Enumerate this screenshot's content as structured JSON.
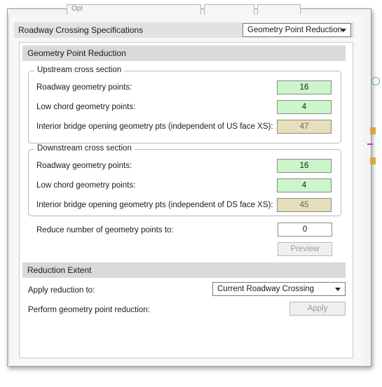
{
  "top_strip": {
    "partial_label": "Opt"
  },
  "spec_bar": {
    "title": "Roadway Crossing Specifications",
    "mode_select": "Geometry Point Reduction"
  },
  "gpr": {
    "header": "Geometry Point Reduction",
    "upstream": {
      "title": "Upstream cross section",
      "roadway_label": "Roadway geometry points:",
      "roadway_value": "16",
      "lowchord_label": "Low chord geometry points:",
      "lowchord_value": "4",
      "interior_label": "Interior bridge opening geometry pts (independent of US face XS):",
      "interior_value": "47"
    },
    "downstream": {
      "title": "Downstream cross section",
      "roadway_label": "Roadway geometry points:",
      "roadway_value": "16",
      "lowchord_label": "Low chord geometry points:",
      "lowchord_value": "4",
      "interior_label": "Interior bridge opening geometry pts (independent of DS face XS):",
      "interior_value": "45"
    },
    "reduce_label": "Reduce number of geometry points to:",
    "reduce_value": "0",
    "preview_label": "Preview"
  },
  "extent": {
    "header": "Reduction Extent",
    "apply_to_label": "Apply reduction to:",
    "apply_to_value": "Current Roadway Crossing",
    "perform_label": "Perform geometry point reduction:",
    "apply_label": "Apply"
  },
  "colors": {
    "value_green": "#ccf5cc",
    "value_tan": "#e6dfbb",
    "header_gray": "#d9d9d9"
  }
}
